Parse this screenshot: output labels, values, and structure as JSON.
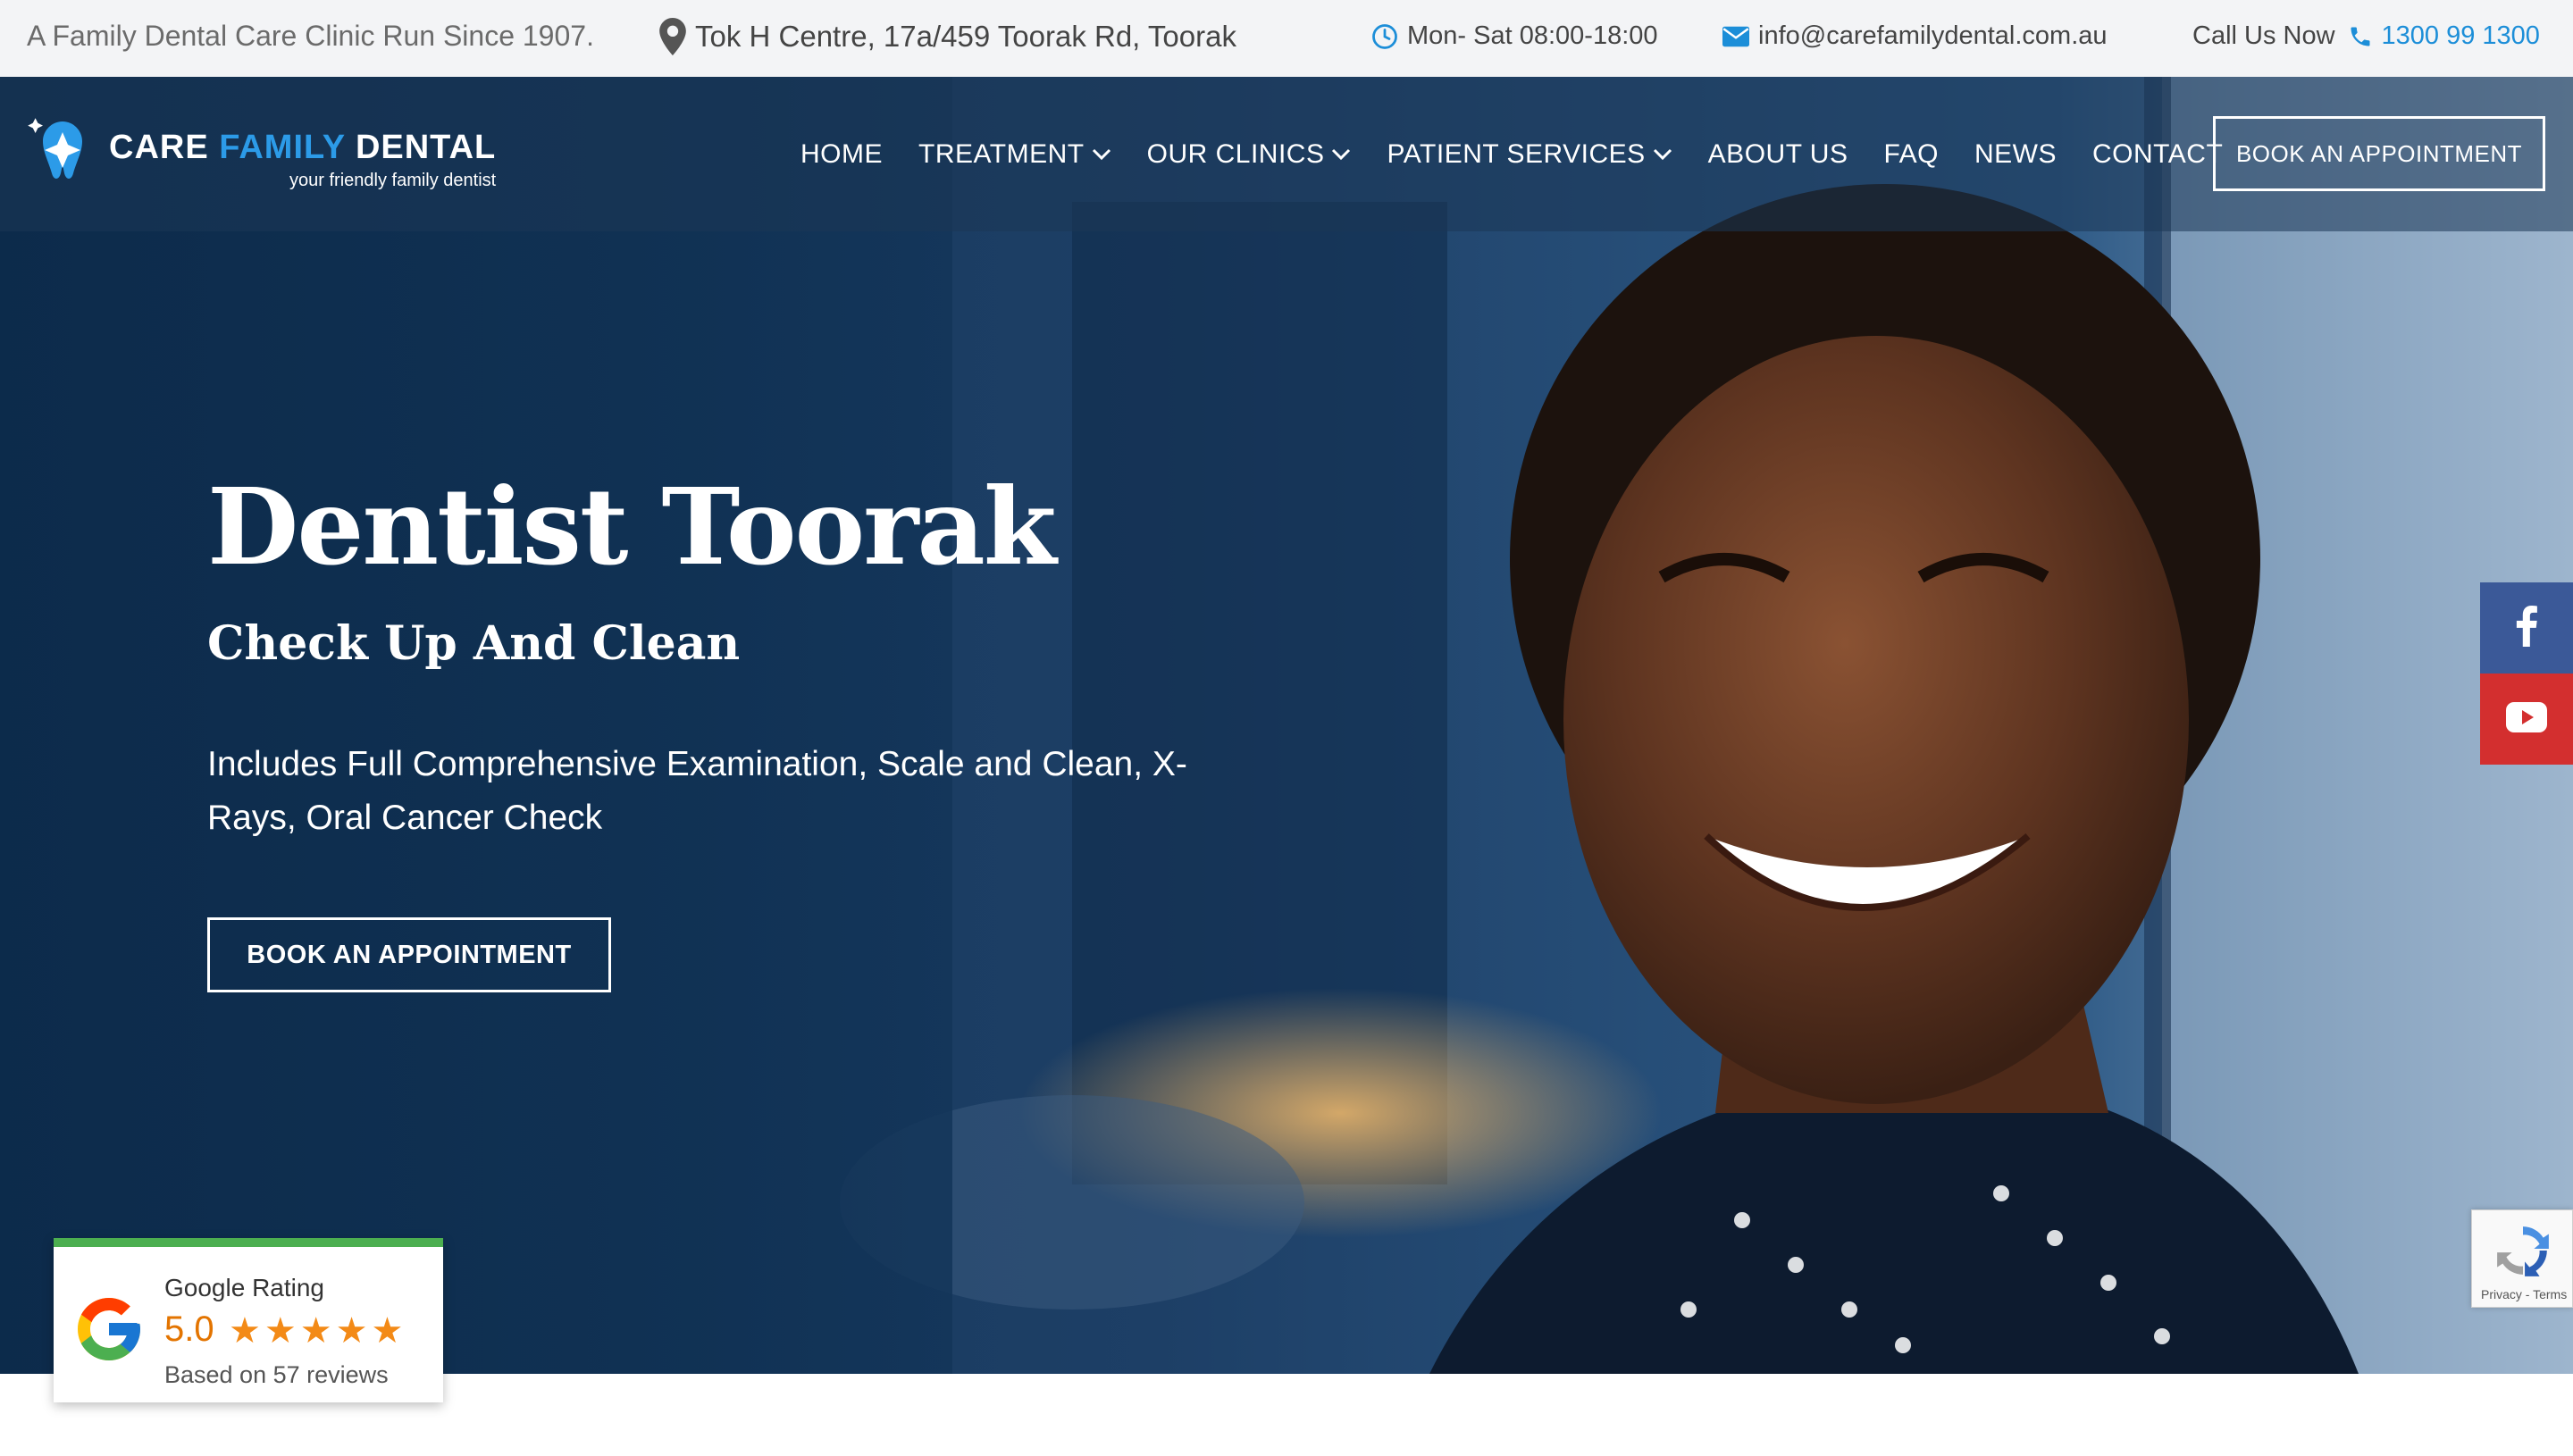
{
  "topbar": {
    "tagline": "A Family Dental Care Clinic Run Since 1907.",
    "address": "Tok H Centre, 17a/459 Toorak Rd, Toorak",
    "hours": "Mon- Sat 08:00-18:00",
    "email": "info@carefamilydental.com.au",
    "call_label": "Call Us Now",
    "phone": "1300 99 1300"
  },
  "logo": {
    "word1": "CARE ",
    "word2": "FAMILY",
    "word3": " DENTAL",
    "tagline": "your friendly family dentist"
  },
  "nav": {
    "items": [
      {
        "label": "HOME",
        "dropdown": false
      },
      {
        "label": "TREATMENT",
        "dropdown": true
      },
      {
        "label": "OUR CLINICS",
        "dropdown": true
      },
      {
        "label": "PATIENT SERVICES",
        "dropdown": true
      },
      {
        "label": "ABOUT US",
        "dropdown": false
      },
      {
        "label": "FAQ",
        "dropdown": false
      },
      {
        "label": "NEWS",
        "dropdown": false
      },
      {
        "label": "CONTACT",
        "dropdown": false
      }
    ],
    "cta": "BOOK AN APPOINTMENT"
  },
  "hero": {
    "title": "Dentist Toorak",
    "subtitle": "Check Up And Clean",
    "description": "Includes Full Comprehensive Examination, Scale and Clean, X-Rays, Oral Cancer Check",
    "cta": "BOOK AN APPOINTMENT"
  },
  "google_rating": {
    "label": "Google Rating",
    "score": "5.0",
    "stars": 5,
    "reviews": "Based on 57 reviews"
  },
  "recaptcha": {
    "text": "Privacy - Terms"
  },
  "colors": {
    "accent_blue": "#1c8ed8",
    "hero_overlay": "#0e2d4e",
    "facebook": "#3b5998",
    "youtube": "#d32f2f",
    "rating_star": "#f38a17"
  }
}
